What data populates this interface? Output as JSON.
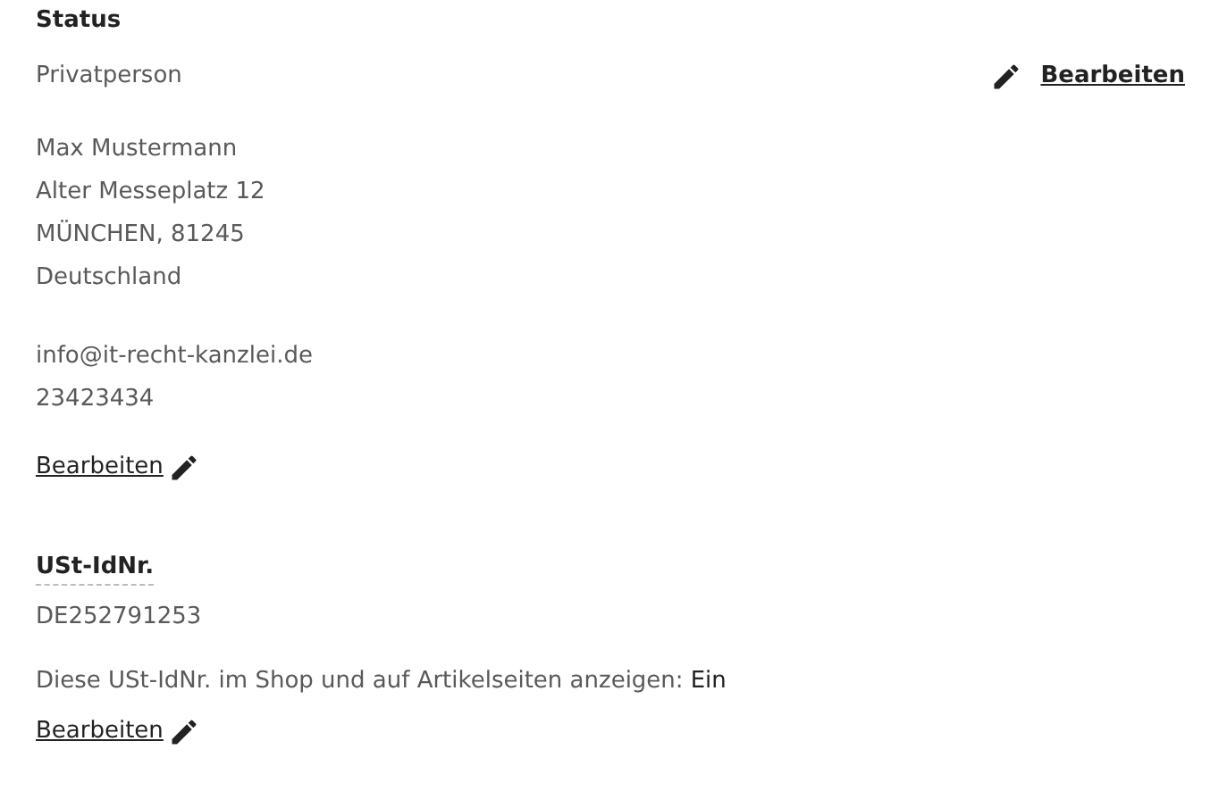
{
  "status": {
    "heading": "Status",
    "value": "Privatperson",
    "edit_link": "Bearbeiten"
  },
  "address": {
    "lines": [
      "Max Mustermann",
      "Alter Messeplatz 12",
      "MÜNCHEN, 81245",
      "Deutschland"
    ],
    "contact": [
      "info@it-recht-kanzlei.de",
      "23423434"
    ],
    "edit_link": "Bearbeiten"
  },
  "vat": {
    "heading": "USt-IdNr.",
    "number": "DE252791253",
    "display_label": "Diese USt-IdNr. im Shop und auf Artikelseiten anzeigen:",
    "display_value": "Ein",
    "edit_link": "Bearbeiten"
  }
}
